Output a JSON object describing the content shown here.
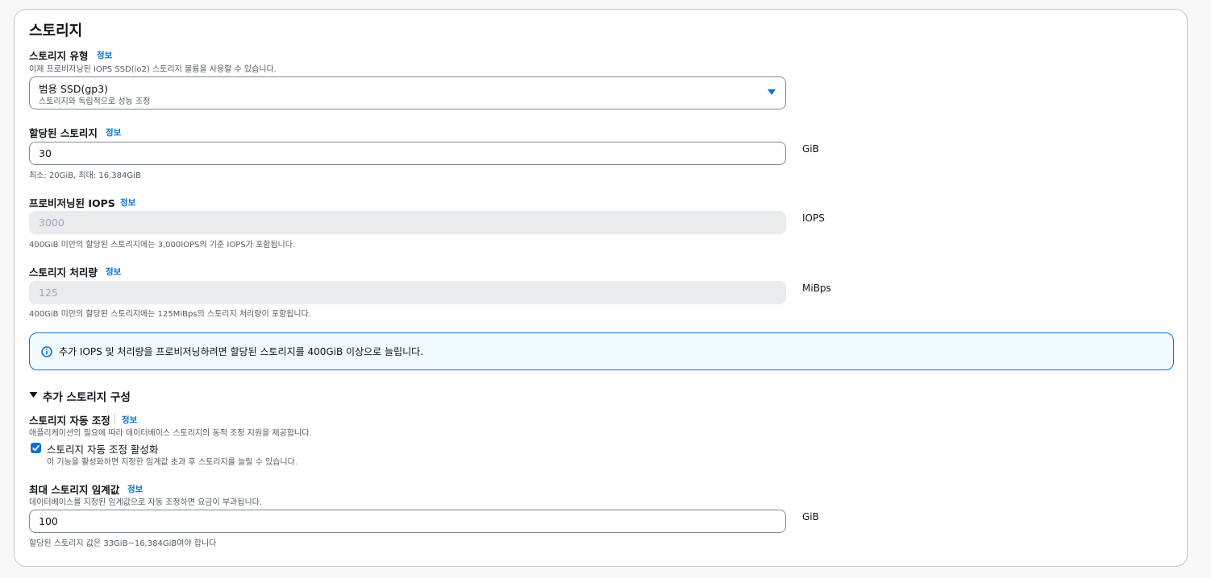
{
  "section": {
    "title": "스토리지"
  },
  "storage_type": {
    "label": "스토리지 유형",
    "info": "정보",
    "description": "이제 프로비저닝된 IOPS SSD(io2) 스토리지 볼륨을 사용할 수 있습니다.",
    "selected_value": "범용 SSD(gp3)",
    "selected_description": "스토리지와 독립적으로 성능 조정",
    "dropdown_icon": "caret-down-icon"
  },
  "allocated_storage": {
    "label": "할당된 스토리지",
    "info": "정보",
    "value": "30",
    "unit": "GiB",
    "hint": "최소: 20GiB, 최대: 16,384GiB"
  },
  "provisioned_iops": {
    "label": "프로비저닝된 IOPS",
    "info": "정보",
    "value": "3000",
    "unit": "IOPS",
    "hint": "400GiB 미만의 할당된 스토리지에는 3,000IOPS의 기준 IOPS가 포함됩니다."
  },
  "storage_throughput": {
    "label": "스토리지 처리량",
    "info": "정보",
    "value": "125",
    "unit": "MiBps",
    "hint": "400GiB 미만의 할당된 스토리지에는 125MiBps의 스토리지 처리량이 포함됩니다."
  },
  "alert": {
    "icon": "info-circle-icon",
    "text": "추가 IOPS 및 처리량을 프로비저닝하려면 할당된 스토리지를 400GiB 이상으로 늘립니다."
  },
  "additional_config": {
    "toggle_label": "추가 스토리지 구성",
    "expanded": true
  },
  "autoscaling": {
    "label": "스토리지 자동 조정",
    "info": "정보",
    "description": "애플리케이션의 필요에 따라 데이터베이스 스토리지의 동적 조정 지원을 제공합니다.",
    "checkbox_label": "스토리지 자동 조정 활성화",
    "checkbox_checked": true,
    "checkbox_description": "이 기능을 활성화하면 지정한 임계값 초과 후 스토리지를 늘릴 수 있습니다."
  },
  "max_storage_threshold": {
    "label": "최대 스토리지 임계값",
    "info": "정보",
    "description": "데이터베이스를 지정된 임계값으로 자동 조정하면 요금이 부과됩니다.",
    "value": "100",
    "unit": "GiB",
    "hint": "할당된 스토리지 값은 33GiB~16,384GiB여야 합니다"
  },
  "colors": {
    "link": "#0972d3",
    "alert_background": "#f1faff",
    "border": "#7d8998",
    "disabled_background": "#e9ebed"
  }
}
